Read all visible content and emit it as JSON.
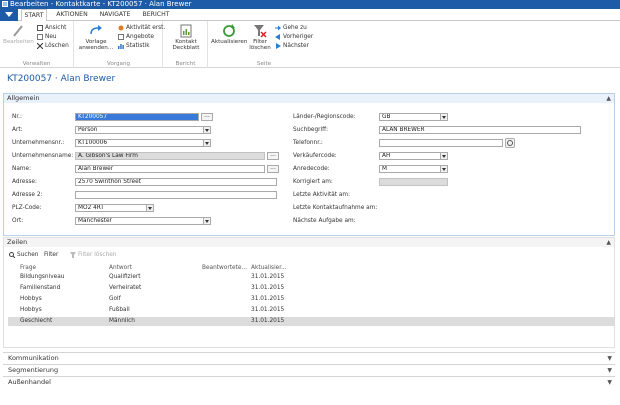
{
  "window": {
    "title": "Bearbeiten - Kontaktkarte - KT200057 · Alan Brewer"
  },
  "ribbon_tabs": [
    "START",
    "AKTIONEN",
    "NAVIGATE",
    "BERICHT"
  ],
  "ribbon": {
    "verwalten": {
      "label": "Verwalten",
      "edit": "Bearbeiten",
      "view": "Ansicht",
      "new": "Neu",
      "delete": "Löschen"
    },
    "vorgang": {
      "label": "Vorgang",
      "template": "Vorlage anwenden...",
      "activity": "Aktivität erst.",
      "quotes": "Angebote",
      "stats": "Statistik"
    },
    "bericht": {
      "label": "Bericht",
      "cover": "Kontakt Deckblatt"
    },
    "seite": {
      "label": "Seite",
      "refresh": "Aktualisieren",
      "clear_filter": "Filter löschen",
      "goto": "Gehe zu",
      "prev": "Vorheriger",
      "next": "Nächster"
    }
  },
  "page": {
    "title": "KT200057 · Alan Brewer"
  },
  "allgemein": {
    "title": "Allgemein",
    "left": [
      {
        "label": "Nr.:",
        "value": "KT200057"
      },
      {
        "label": "Art:",
        "value": "Person"
      },
      {
        "label": "Unternehmensnr.:",
        "value": "KT100006"
      },
      {
        "label": "Unternehmensname:",
        "value": "A. Gibson's Law Firm"
      },
      {
        "label": "Name:",
        "value": "Alan Brewer"
      },
      {
        "label": "Adresse:",
        "value": "2570 Swinthon Street"
      },
      {
        "label": "Adresse 2:",
        "value": ""
      },
      {
        "label": "PLZ-Code:",
        "value": "MO2 4RT"
      },
      {
        "label": "Ort:",
        "value": "Manchester"
      }
    ],
    "right": [
      {
        "label": "Länder-/Regionscode:",
        "value": "GB"
      },
      {
        "label": "Suchbegriff:",
        "value": "ALAN BREWER"
      },
      {
        "label": "Telefonnr.:",
        "value": ""
      },
      {
        "label": "Verkäufercode:",
        "value": "AH"
      },
      {
        "label": "Anredecode:",
        "value": "M"
      },
      {
        "label": "Korrigiert am:",
        "value": ""
      },
      {
        "label": "Letzte Aktivität am:",
        "value": ""
      },
      {
        "label": "Letzte Kontaktaufnahme am:",
        "value": ""
      },
      {
        "label": "Nächste Aufgabe am:",
        "value": ""
      }
    ]
  },
  "zeilen": {
    "title": "Zeilen",
    "toolbar": {
      "search": "Suchen",
      "filter": "Filter",
      "clear": "Filter löschen"
    },
    "columns": [
      "Frage",
      "Antwort",
      "Beantwortete...",
      "Aktualisier..."
    ],
    "rows": [
      {
        "frage": "Bildungsniveau",
        "antwort": "Qualifiziert",
        "beantwortet": "",
        "aktualisiert": "31.01.2015"
      },
      {
        "frage": "Familienstand",
        "antwort": "Verheiratet",
        "beantwortet": "",
        "aktualisiert": "31.01.2015"
      },
      {
        "frage": "Hobbys",
        "antwort": "Golf",
        "beantwortet": "",
        "aktualisiert": "31.01.2015"
      },
      {
        "frage": "Hobbys",
        "antwort": "Fußball",
        "beantwortet": "",
        "aktualisiert": "31.01.2015"
      },
      {
        "frage": "Geschlecht",
        "antwort": "Männlich",
        "beantwortet": "",
        "aktualisiert": "31.01.2015"
      }
    ]
  },
  "collapsed_sections": [
    "Kommunikation",
    "Segmentierung",
    "Außenhandel"
  ],
  "colors": {
    "accent": "#1d5aa8",
    "selection": "#3879d9"
  }
}
